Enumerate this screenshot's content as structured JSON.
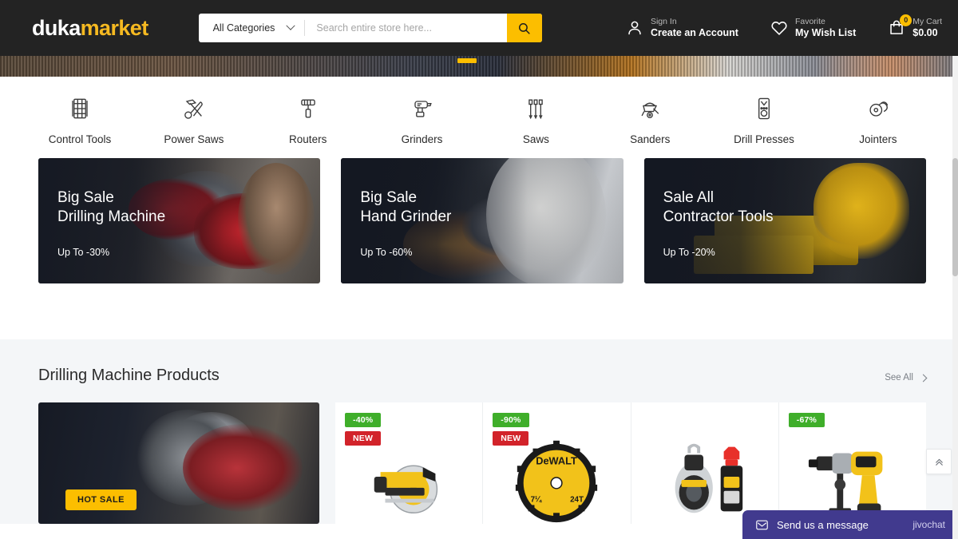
{
  "header": {
    "logo_duka": "duka",
    "logo_market": "market",
    "search": {
      "category_label": "All Categories",
      "placeholder": "Search entire store here...",
      "value": "",
      "button_icon": "search-icon"
    },
    "actions": [
      {
        "icon": "user-icon",
        "top": "Sign In",
        "bottom": "Create an Account"
      },
      {
        "icon": "heart-icon",
        "top": "Favorite",
        "bottom": "My Wish List"
      },
      {
        "icon": "cart-icon",
        "top": "My Cart",
        "bottom": "$0.00",
        "badge": "0"
      }
    ]
  },
  "categories": [
    {
      "label": "Control Tools",
      "icon": "control-tools-icon"
    },
    {
      "label": "Power Saws",
      "icon": "power-saws-icon"
    },
    {
      "label": "Routers",
      "icon": "routers-icon"
    },
    {
      "label": "Grinders",
      "icon": "grinders-icon"
    },
    {
      "label": "Saws",
      "icon": "saws-icon"
    },
    {
      "label": "Sanders",
      "icon": "sanders-icon"
    },
    {
      "label": "Drill Presses",
      "icon": "drill-presses-icon"
    },
    {
      "label": "Jointers",
      "icon": "jointers-icon"
    }
  ],
  "promos": [
    {
      "line1": "Big Sale",
      "line2": "Drilling Machine",
      "sub": "Up To -30%"
    },
    {
      "line1": "Big Sale",
      "line2": "Hand Grinder",
      "sub": "Up To -60%"
    },
    {
      "line1": "Sale All",
      "line2": "Contractor Tools",
      "sub": "Up To -20%"
    }
  ],
  "section": {
    "title": "Drilling Machine Products",
    "see_all": "See All",
    "feature_badge": "HOT SALE",
    "products": [
      {
        "name": "circular-saw",
        "discount": "-40%",
        "new": "NEW"
      },
      {
        "name": "saw-blade",
        "discount": "-90%",
        "new": "NEW"
      },
      {
        "name": "chalk-line-set",
        "discount": "",
        "new": ""
      },
      {
        "name": "hammer-drill",
        "discount": "-67%",
        "new": ""
      }
    ]
  },
  "widgets": {
    "chat_message": "Send us a message",
    "chat_brand": "jivochat",
    "to_top_icon": "double-chevron-up-icon"
  },
  "colors": {
    "brand_yellow": "#fcbe00",
    "header_dark": "#232323",
    "discount_green": "#3fae2a",
    "new_red": "#d2232a",
    "chat_purple": "#413a8e"
  }
}
